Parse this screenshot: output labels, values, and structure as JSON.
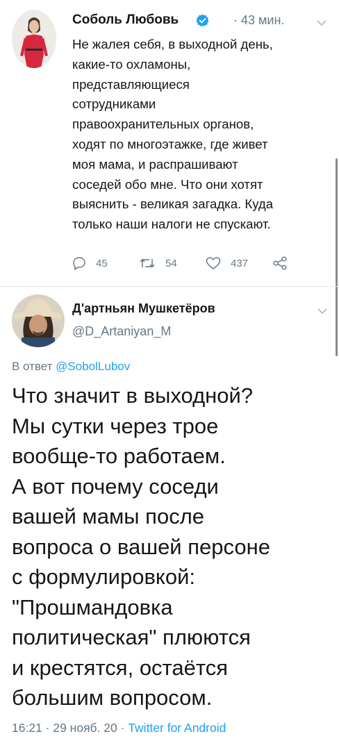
{
  "tweet": {
    "author_name": "Соболь Любовь",
    "time": "· 43 мин.",
    "text_lines": [
      "Не жалея себя, в выходной день,",
      "какие-то охламоны,",
      "представляющиеся",
      "сотрудниками",
      "правоохранительных органов,",
      "ходят по многоэтажке, где живет",
      "моя мама, и распрашивают",
      "соседей обо мне. Что они хотят",
      "выяснить - великая загадка. Куда",
      "только наши налоги не спускают."
    ],
    "replies": "45",
    "retweets": "54",
    "likes": "437"
  },
  "reply": {
    "author_name": "Д'артньян Мушкетёров",
    "handle": "@D_Artaniyan_M",
    "reply_prefix": "В ответ ",
    "reply_mention": "@SobolLubov",
    "text_lines": [
      "Что значит в выходной?",
      "Мы сутки через трое",
      "вообще-то работаем.",
      "А вот почему соседи",
      "вашей мамы после",
      "вопроса о вашей персоне",
      "с формулировкой:",
      "\"Прошмандовка",
      "политическая\" плюются",
      "и крестятся, остаётся",
      "большим вопросом."
    ],
    "timestamp": "16:21 · 29 нояб. 20 · ",
    "source": "Twitter for Android"
  },
  "colors": {
    "accent": "#1da1f2",
    "secondary_text": "#657786",
    "divider": "#e1e8ed"
  }
}
